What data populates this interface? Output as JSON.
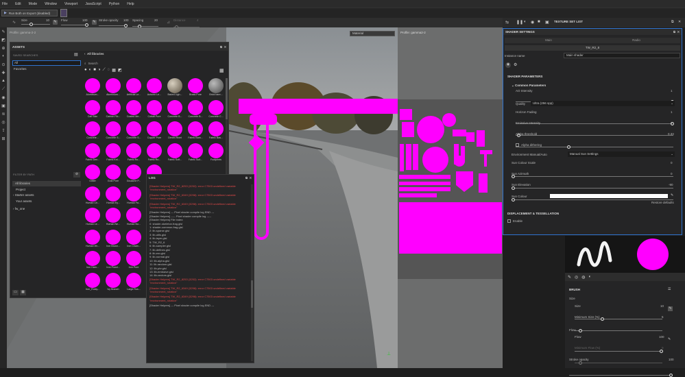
{
  "menu": [
    "File",
    "Edit",
    "Mode",
    "Window",
    "Viewport",
    "JavaScript",
    "Python",
    "Help"
  ],
  "top": {
    "status": "Run Both on Export (disabled)"
  },
  "toolbar": {
    "size_label": "Size",
    "size_value": "10",
    "flow_label": "Flow",
    "flow_value": "100",
    "stroke_label": "Stroke opacity",
    "stroke_value": "100",
    "spacing_label": "Spacing",
    "spacing_value": "20",
    "distance_label": "Distance",
    "distance_value": "4"
  },
  "viewport": {
    "left_label": "Profile: gamma-2-2",
    "material_select": "Material",
    "right_label": "Profile: gamma2-2"
  },
  "assets": {
    "title": "ASSETS",
    "saved_searches": "SAVED SEARCHES",
    "all": "All",
    "favorites": "Favorites",
    "libraries_title": "All libraries",
    "search_placeholder": "Search",
    "filter_title": "FILTER BY PATH",
    "tree": [
      "All libraries",
      "Project",
      "Starter assets",
      "Your assets"
    ],
    "tree2": "fw_one",
    "grid": [
      [
        "Aluminum...",
        "Aluminium...",
        "Artificial Le...",
        "Autumn Le...",
        "Baked Ligh...",
        "Brass Pure",
        "Brick bare..."
      ],
      [
        "Calf Skin",
        "Carbon Fib...",
        "Coated Me...",
        "Cobalt Pure",
        "Concrete B...",
        "Concrete B...",
        "Concrete C..."
      ],
      [
        "Concrete...",
        "Concrete S...",
        "Concrete S...",
        "Copper Pure",
        "Denim Rivet",
        "Fabric Bam...",
        "Fabric Bas..."
      ],
      [
        "Fabric Den...",
        "Fabric Kni...",
        "Fabric Ro...",
        "Fabric Ro...",
        "Fabric Soft...",
        "Fabric Suit...",
        "Footprints"
      ],
      [
        "Glitter",
        "Gold Pure",
        "Gouache P...",
        "Grou...",
        "",
        "",
        ""
      ],
      [
        "Human Ch...",
        "Human Ey...",
        "Human Fa...",
        "",
        "",
        "",
        ""
      ],
      [
        "Human Le...",
        "Human Ne...",
        "Human No...",
        "",
        "",
        "",
        ""
      ],
      [
        "Human Wr...",
        "Iron Brush...",
        "Iron Chain...",
        "",
        "",
        "",
        ""
      ],
      [
        "Iron Ham...",
        "Iron Powd...",
        "Iron Pure",
        "",
        "",
        "",
        ""
      ],
      [
        "Iron_Rusty...",
        "Ivy Branch",
        "Large Rus...",
        "Leath...",
        "",
        "",
        ""
      ]
    ]
  },
  "log": {
    "title": "LOG",
    "lines": [
      {
        "t": "[Shader Helpers] TW_R2_8253 (3252): error C7503 undefined variable \"environment_rotation\"",
        "err": true
      },
      {
        "t": "[Shader Helpers] TW_R2_6349 (3298): error C7503 undefined variable \"environment_rotation\"",
        "err": true
      },
      {
        "t": "[Shader Helpers] TW_R2_6349 (3298): error C7503 undefined variable \"environment_rotation\"",
        "err": true
      },
      {
        "t": "[Shader Helpers] --- Pixel shader compile log END ---",
        "err": false
      },
      {
        "t": "[Shader Helpers] ----- Pixel shader compile log -----",
        "err": false
      },
      {
        "t": "[Shader Helpers] File index:",
        "err": false
      },
      {
        "t": "  0: shader-skeleton.frag.glsl",
        "err": false
      },
      {
        "t": "  1: shader-common.frag.glsl",
        "err": false
      },
      {
        "t": "  2: lib-sparse.glsl",
        "err": false
      },
      {
        "t": "  3: lib-utils.glsl",
        "err": false
      },
      {
        "t": "  4: lib-layer.glsl",
        "err": false
      },
      {
        "t": "  5: TW_R2_6",
        "err": false
      },
      {
        "t": "  6: lib-sampler.glsl",
        "err": false
      },
      {
        "t": "  7: lib-defines.glsl",
        "err": false
      },
      {
        "t": "  8: lib-env.glsl",
        "err": false
      },
      {
        "t": "  9: lib-normal.glsl",
        "err": false
      },
      {
        "t": "  10: lib-alpha.glsl",
        "err": false
      },
      {
        "t": "  11: lib-random.glsl",
        "err": false
      },
      {
        "t": "  12: lib-pbr.glsl",
        "err": false
      },
      {
        "t": "  13: lib-emissive.glsl",
        "err": false
      },
      {
        "t": "  14: lib-vectors.glsl",
        "err": false
      },
      {
        "t": "[Shader Helpers] TW_R2_8253 (3252): error C7503 undefined variable \"environment_rotation\"",
        "err": true
      },
      {
        "t": "[Shader Helpers] TW_R2_6349 (3298): error C7503 undefined variable \"environment_rotation\"",
        "err": true
      },
      {
        "t": "[Shader Helpers] TW_R2_6349 (3298): error C7503 undefined variable \"environment_rotation\"",
        "err": true
      },
      {
        "t": "[Shader Helpers] --- Pixel shader compile log END ---",
        "err": false
      }
    ]
  },
  "texture_set_list": "TEXTURE SET LIST",
  "shader": {
    "title": "SHADER SETTINGS",
    "tab1": "Main",
    "tab2": "Radio",
    "shader_name": "TW_R2_8",
    "instance_label": "Instance name",
    "instance_value": "Main shader",
    "params_title": "SHADER PARAMETERS",
    "common_title": "Common Parameters",
    "ao_label": "AO Intensity",
    "ao_value": "1",
    "quality_label": "Quality",
    "quality_value": "Ultra (256 spp)",
    "horizon_label": "Horizon Fading",
    "horizon_value": "1",
    "emissive_label": "Emissive Intensity",
    "emissive_value": "1",
    "alpha_label": "Alpha threshold",
    "alpha_value": "0.33",
    "alpha_dither": "Alpha dithering",
    "env_label": "Environment Manual/Auto",
    "env_value": "Manual Sun Settings",
    "sun_scale_label": "Sun Colour Scale",
    "sun_scale_value": "0",
    "sun_azimuth_label": "Sun Azimuth",
    "sun_azimuth_value": "0",
    "sun_elev_label": "Sun Elevation",
    "sun_elev_value": "-90",
    "sun_colour_label": "Sun Colour",
    "restore": "Restore defaults",
    "disp_title": "DISPLACEMENT & TESSELLATION",
    "enable": "Enable"
  },
  "brush": {
    "title": "BRUSH",
    "size_section": "Size",
    "size_label": "Size",
    "size_value": "10",
    "minsize_label": "Minimum Size (%)",
    "minsize_value": "5",
    "flow_section": "Flow",
    "flow_label": "Flow",
    "flow_value": "100",
    "minflow_label": "Minimum Flow (%)",
    "minflow_value": "0",
    "stroke_label": "Stroke opacity",
    "stroke_value": "100"
  },
  "colors": {
    "accent": "#ff00ff",
    "panel": "#252526",
    "viewport": "#6d6e6e",
    "error": "#e04848",
    "focus": "#2f74d0"
  }
}
